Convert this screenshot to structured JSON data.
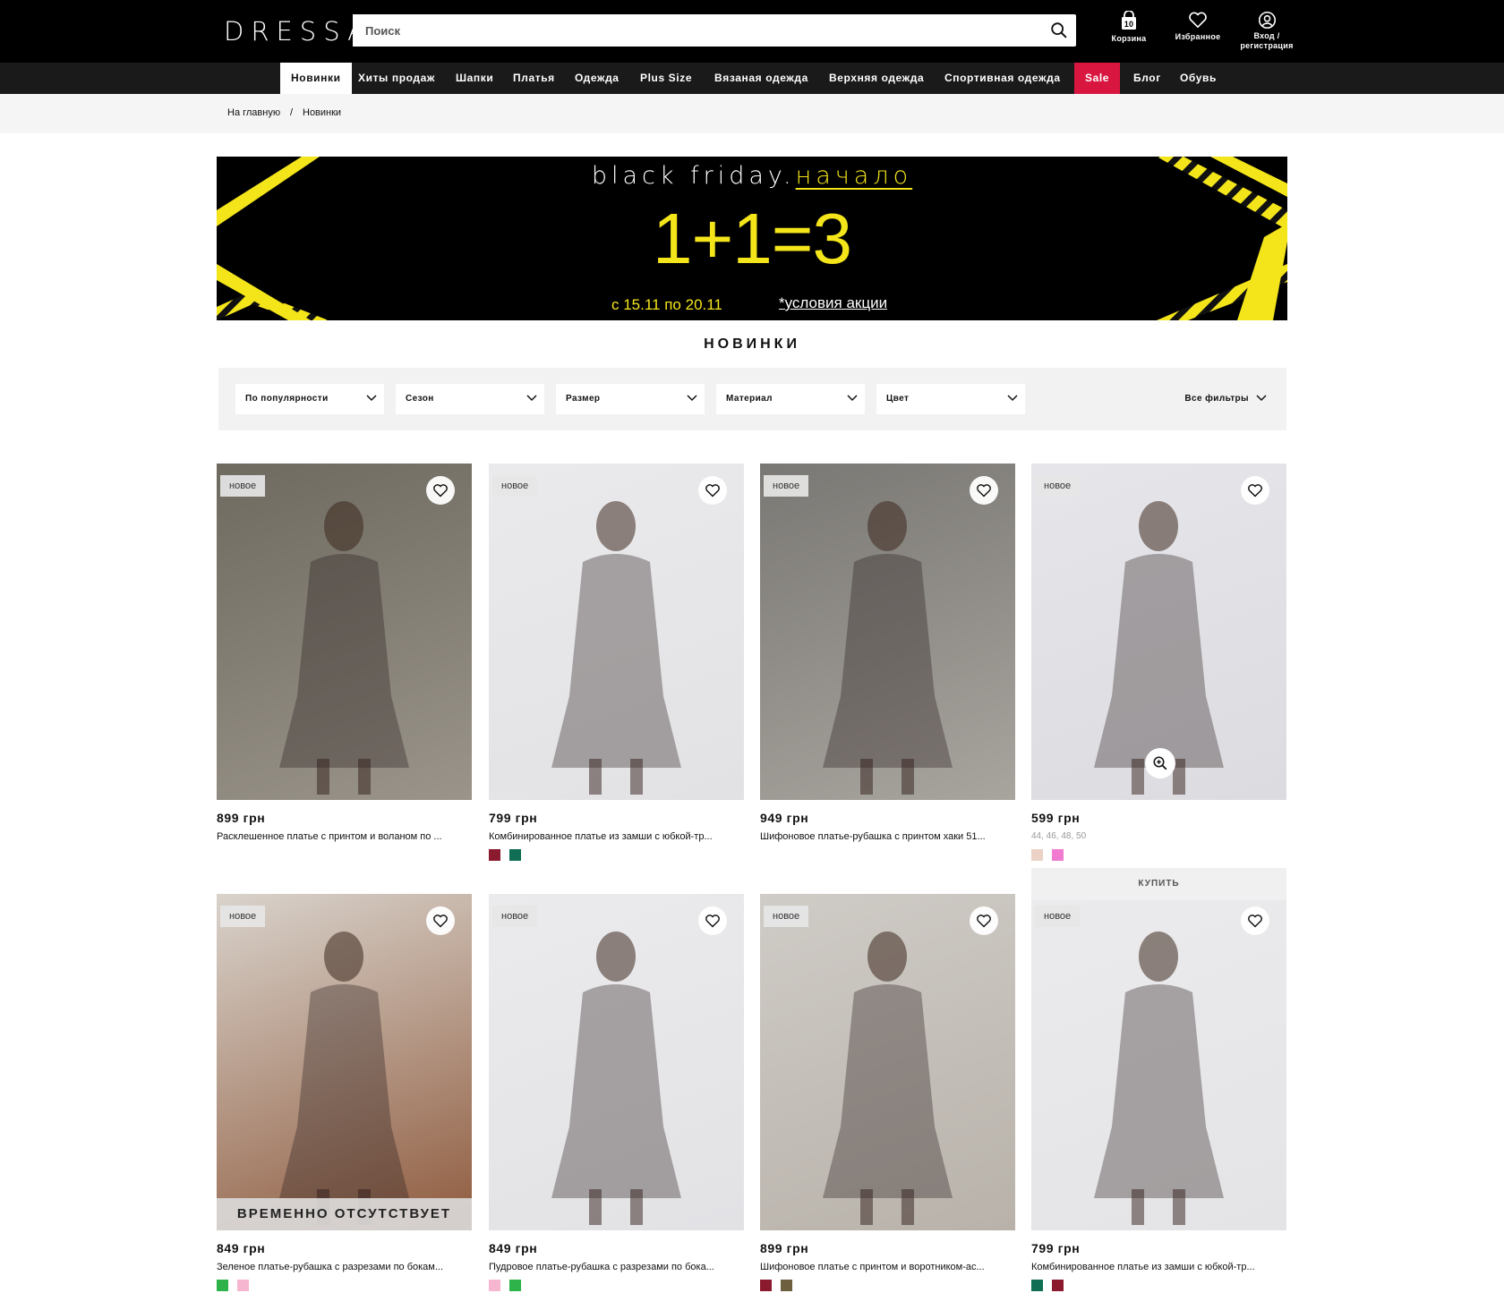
{
  "header": {
    "logo": "DRESSA",
    "search_placeholder": "Поиск",
    "cart_label": "Корзина",
    "cart_count": "10",
    "favorites_label": "Избранное",
    "login_line1": "Вход /",
    "login_line2": "регистрация"
  },
  "nav": {
    "items": [
      "Новинки",
      "Хиты продаж",
      "Шапки",
      "Платья",
      "Одежда",
      "Plus Size",
      "Вязаная одежда",
      "Верхняя одежда",
      "Спортивная одежда",
      "Sale",
      "Блог",
      "Обувь"
    ],
    "active": "Новинки",
    "highlight": "Sale",
    "highlight_color": "#d9163f"
  },
  "breadcrumb": {
    "home": "На главную",
    "separator": "/",
    "current": "Новинки"
  },
  "banner": {
    "title_part1": "black friday.",
    "title_part2": "начало",
    "offer": "1+1=3",
    "dates": "с 15.11 по 20.11",
    "conditions": "*условия акции",
    "accent_color": "#f4e51b"
  },
  "section_title": "НОВИНКИ",
  "filters": {
    "sort": "По популярности",
    "season": "Сезон",
    "size": "Размер",
    "material": "Материал",
    "color": "Цвет",
    "all": "Все фильтры"
  },
  "products": [
    {
      "badge": "новое",
      "price": "899 грн",
      "name": "Расклешенное платье с принтом и воланом по ...",
      "colors": [],
      "bg": [
        "#6e6a60",
        "#9a948a"
      ]
    },
    {
      "badge": "новое",
      "price": "799 грн",
      "name": "Комбинированное платье из замши с юбкой-тр...",
      "colors": [
        "#8b1a2e",
        "#0f6e54"
      ],
      "bg": [
        "#eaeaec",
        "#e2e2e4"
      ]
    },
    {
      "badge": "новое",
      "price": "949 грн",
      "name": "Шифоновое платье-рубашка с принтом хаки 51...",
      "colors": [],
      "bg": [
        "#7a7874",
        "#a8a49e"
      ]
    },
    {
      "badge": "новое",
      "price": "599 грн",
      "name": "",
      "sizes": "44, 46, 48, 50",
      "colors": [
        "#ecd2c6",
        "#f07bd0"
      ],
      "bg": [
        "#e6e6ea",
        "#dcdce0"
      ]
    },
    {
      "badge": "новое",
      "price": "849 грн",
      "name": "Зеленое платье-рубашка с разрезами по бокам...",
      "colors": [
        "#2db34a",
        "#f7b6cf"
      ],
      "status": "ВРЕМЕННО ОТСУТСТВУЕТ",
      "bg": [
        "#d9d3cc",
        "#8f5b3e"
      ]
    },
    {
      "badge": "новое",
      "price": "849 грн",
      "name": "Пудровое платье-рубашка с разрезами по бока...",
      "colors": [
        "#f7b6cf",
        "#2db34a"
      ],
      "bg": [
        "#ebebed",
        "#e2e2e5"
      ]
    },
    {
      "badge": "новое",
      "price": "899 грн",
      "name": "Шифоновое платье с принтом и воротником-ас...",
      "colors": [
        "#8b1a2e",
        "#6e5f3e"
      ],
      "bg": [
        "#cfcbc6",
        "#b8b2aa"
      ]
    },
    {
      "badge": "новое",
      "price": "799 грн",
      "name": "Комбинированное платье из замши с юбкой-тр...",
      "colors": [
        "#0f6e54",
        "#8b1a2e"
      ],
      "bg": [
        "#ebebed",
        "#e4e4e6"
      ]
    }
  ],
  "buy_label": "КУПИТЬ"
}
